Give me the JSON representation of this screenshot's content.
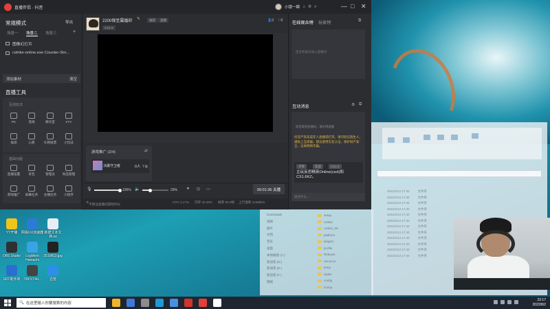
{
  "app": {
    "title": "直播伴侣 · 抖音",
    "username": "小银一瞬",
    "window_controls": [
      "—",
      "□",
      "✕"
    ]
  },
  "left_panel": {
    "mode_label": "常规模式",
    "import_label": "导出",
    "scene_tabs": [
      "场景一",
      "场景二",
      "场景三"
    ],
    "sources": [
      "图像幻灯片",
      "cstrike-online.exe Counter-Stri..."
    ],
    "add_source_label": "添加素材",
    "clear_label": "清空",
    "tools_header": "直播工具",
    "section_interactive": "互动玩法",
    "interactive_tools": [
      "PK",
      "连线",
      "聊天室",
      "KTV",
      "福袋",
      "心愿",
      "礼物投票",
      "小玩法"
    ],
    "section_basic": "基础功能",
    "basic_tools": [
      "直播设置",
      "背包",
      "管理员",
      "商品管理",
      "游戏推广",
      "屏幕任务",
      "主播任务",
      "小程序"
    ]
  },
  "center": {
    "stream_title": "2200保至属婚印",
    "chips": [
      "福袋",
      "直播",
      "CS1.6"
    ],
    "stat_viewers": "0",
    "stat_likes": "0",
    "promo_header": "游戏推广 (2/4)",
    "promo_item_name": "决屠守卫者",
    "promo_item_count": "0人",
    "promo_item_action": "下载",
    "mic_pct": "100%",
    "speaker_pct": "29%",
    "live_button": "00:01:36 关播",
    "status": {
      "hint": "不建议直播间游戏时长",
      "cpu": "CPU 3.17%",
      "mem": "内存 20.28%",
      "fps": "帧率 60.0帧",
      "upload": "上行速率 2158kb/s"
    }
  },
  "right_panel": {
    "tabs": [
      "在线观众榜",
      "玩家榜"
    ],
    "empty_audience": "还没有观众加入直播间",
    "chat_header": "互动消息",
    "chat_system": "欢迎来到直播间，请文明直播",
    "chat_warning": "抖音严禁未成年人直播或打赏，请勿轻信陌生人，谨防上当受骗，建议使用实名认证，保护财产安全，远离网络诈骗。",
    "chat_tags": [
      "点赞",
      "欢迎",
      "CS1.6"
    ],
    "chat_message": "主玩反恐精英Online(csol)和CS1.6KZ。",
    "chat_input_placeholder": "说点什么..."
  },
  "desktop": {
    "icons": [
      {
        "label": "YY开播",
        "color": "#f0c419"
      },
      {
        "label": "网易UU加速器",
        "color": "#2b7bd6"
      },
      {
        "label": "新建文本文档.txt",
        "color": "#e6eef5"
      },
      {
        "label": "OBS Studio",
        "color": "#303030"
      },
      {
        "label": "LogMeIn Hamachi",
        "color": "#3aa3e3"
      },
      {
        "label": "251MG3.jpg",
        "color": "#222"
      },
      {
        "label": "SDT助手单",
        "color": "#2a6fd0"
      },
      {
        "label": "7997c74d...",
        "color": "#444"
      },
      {
        "label": "迅雷",
        "color": "#2e8fe8"
      }
    ],
    "explorer_folders": [
      "setup",
      "cstrike",
      "cstrike_hd",
      "platform",
      "plugins",
      "profile",
      "Release",
      "resource",
      "temp",
      "styles",
      "config",
      "tcomp"
    ],
    "explorer_side": [
      "Downloads",
      "视频",
      "图片",
      "文档",
      "音乐",
      "桌面",
      "本地磁盘 (C:)",
      "新加卷 (D:)",
      "新加卷 (E:)",
      "新加卷 (F:)",
      "网络"
    ],
    "explorer_dates": [
      "2022/2/13 17:40",
      "2022/2/13 17:40",
      "2022/2/13 17:40",
      "2022/2/13 17:40",
      "2022/2/13 17:40",
      "2022/2/13 17:40",
      "2022/2/13 17:40",
      "2022/2/13 17:40",
      "2022/2/13 17:40",
      "2022/2/13 17:40",
      "2022/2/13 17:40",
      "2022/2/13 17:40"
    ],
    "explorer_type": "文件夹"
  },
  "taskbar": {
    "search_placeholder": "在这里输入你要搜索的内容",
    "time": "22:17",
    "date": "2022/8/2",
    "apps": [
      "#f0b428",
      "#3e7bd8",
      "#8c8c8c",
      "#1f9ad6",
      "#4a90e2",
      "#d0342c",
      "#e0413a",
      "#ffffff"
    ]
  }
}
